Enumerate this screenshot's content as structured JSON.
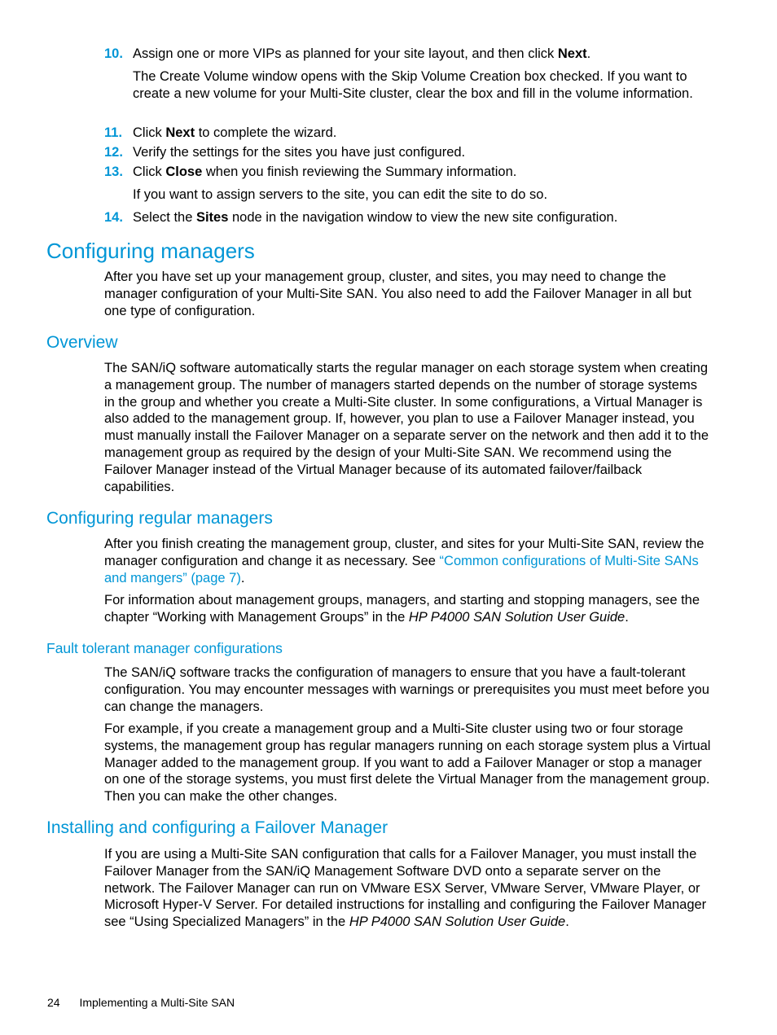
{
  "steps": [
    {
      "num": "10.",
      "pre": "Assign one or more VIPs as planned for your site layout, and then click ",
      "bold": "Next",
      "post": "."
    },
    {
      "num": "11.",
      "pre": "Click ",
      "bold": "Next",
      "post": " to complete the wizard."
    },
    {
      "num": "12.",
      "pre": "Verify the settings for the sites you have just configured.",
      "bold": "",
      "post": ""
    },
    {
      "num": "13.",
      "pre": "Click ",
      "bold": "Close",
      "post": " when you finish reviewing the Summary information."
    },
    {
      "num": "14.",
      "pre": "Select the ",
      "bold": "Sites",
      "post": " node in the navigation window to view the new site configuration."
    }
  ],
  "step10_note": "The Create Volume window opens with the Skip Volume Creation box checked. If you want to create a new volume for your Multi-Site cluster, clear the box and fill in the volume information.",
  "step13_note": "If you want to assign servers to the site, you can edit the site to do so.",
  "sections": {
    "configuring_managers": {
      "title": "Configuring managers",
      "body": "After you have set up your management group, cluster, and sites, you may need to change the manager configuration of your Multi-Site SAN. You also need to add the Failover Manager in all but one type of configuration."
    },
    "overview": {
      "title": "Overview",
      "body": "The SAN/iQ software automatically starts the regular manager on each storage system when creating a management group. The number of managers started depends on the number of storage systems in the group and whether you create a Multi-Site cluster. In some configurations, a Virtual Manager is also added to the management group. If, however, you plan to use a Failover Manager instead, you must manually install the Failover Manager on a separate server on the network and then add it to the management group as required by the design of your Multi-Site SAN. We recommend using the Failover Manager instead of the Virtual Manager because of its automated failover/failback capabilities."
    },
    "regular_managers": {
      "title": "Configuring regular managers",
      "body1_pre": "After you finish creating the management group, cluster, and sites for your Multi-Site SAN, review the manager configuration and change it as necessary. See ",
      "body1_link": "“Common configurations of Multi-Site SANs and mangers” (page 7)",
      "body1_post": ".",
      "body2_pre": "For information about management groups, managers, and starting and stopping managers, see the chapter “Working with Management Groups” in the ",
      "body2_italic": "HP P4000 SAN Solution User Guide",
      "body2_post": "."
    },
    "fault_tolerant": {
      "title": "Fault tolerant manager configurations",
      "body1": "The SAN/iQ software tracks the configuration of managers to ensure that you have a fault-tolerant configuration. You may encounter messages with warnings or prerequisites you must meet before you can change the managers.",
      "body2": "For example, if you create a management group and a Multi-Site cluster using two or four storage systems, the management group has regular managers running on each storage system plus a Virtual Manager added to the management group. If you want to add a Failover Manager or stop a manager on one of the storage systems, you must first delete the Virtual Manager from the management group. Then you can make the other changes."
    },
    "failover": {
      "title": "Installing and configuring a Failover Manager",
      "body_pre": "If you are using a Multi-Site SAN configuration that calls for a Failover Manager, you must install the Failover Manager from the SAN/iQ Management Software DVD onto a separate server on the network. The Failover Manager can run on VMware ESX Server, VMware Server, VMware Player, or Microsoft Hyper-V Server. For detailed instructions for installing and configuring the Failover Manager see “Using Specialized Managers” in the ",
      "body_italic": "HP P4000 SAN Solution User Guide",
      "body_post": "."
    }
  },
  "footer": {
    "page_number": "24",
    "chapter": "Implementing a Multi-Site SAN"
  }
}
